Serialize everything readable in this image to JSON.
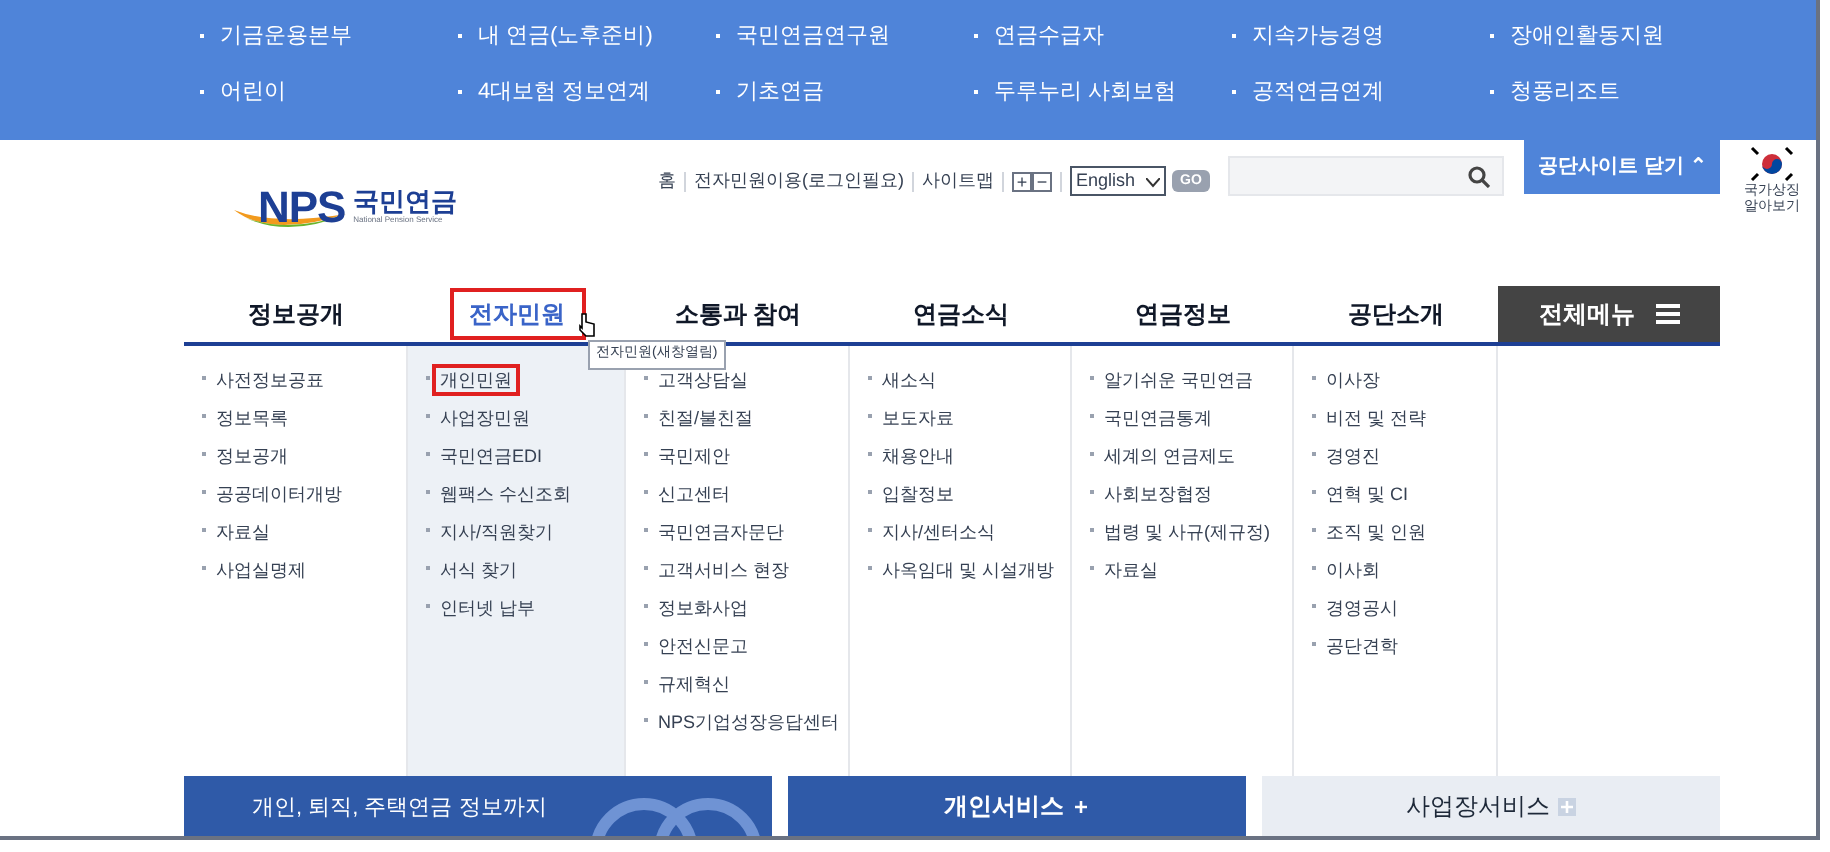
{
  "top_links": [
    [
      "기금운용본부",
      "내 연금(노후준비)",
      "국민연금연구원",
      "연금수급자",
      "지속가능경영",
      "장애인활동지원"
    ],
    [
      "어린이",
      "4대보험 정보연계",
      "기초연금",
      "두루누리 사회보험",
      "공적연금연계",
      "청풍리조트"
    ]
  ],
  "logo": {
    "mark": "NPS",
    "name": "국민연금",
    "tagline": "National Pension Service"
  },
  "utility_links": [
    "홈",
    "전자민원이용(로그인필요)",
    "사이트맵"
  ],
  "font_size_buttons": [
    "+",
    "−"
  ],
  "language_select": {
    "value": "English"
  },
  "go_button": "GO",
  "close_sites_button": "공단사이트 닫기 ⌃",
  "national_symbol": {
    "label": "국가상징 알아보기"
  },
  "nav": [
    {
      "label": "정보공개",
      "selected": false,
      "highlighted": false,
      "items": [
        {
          "label": "사전정보공표",
          "highlighted": false
        },
        {
          "label": "정보목록",
          "highlighted": false
        },
        {
          "label": "정보공개",
          "highlighted": false
        },
        {
          "label": "공공데이터개방",
          "highlighted": false
        },
        {
          "label": "자료실",
          "highlighted": false
        },
        {
          "label": "사업실명제",
          "highlighted": false
        }
      ]
    },
    {
      "label": "전자민원",
      "selected": true,
      "highlighted": true,
      "tooltip": "전자민원(새창열림)",
      "items": [
        {
          "label": "개인민원",
          "highlighted": true
        },
        {
          "label": "사업장민원",
          "highlighted": false
        },
        {
          "label": "국민연금EDI",
          "highlighted": false
        },
        {
          "label": "웹팩스 수신조회",
          "highlighted": false
        },
        {
          "label": "지사/직원찾기",
          "highlighted": false
        },
        {
          "label": "서식 찾기",
          "highlighted": false
        },
        {
          "label": "인터넷 납부",
          "highlighted": false
        }
      ]
    },
    {
      "label": "소통과 참여",
      "selected": false,
      "highlighted": false,
      "items": [
        {
          "label": "고객상담실",
          "highlighted": false
        },
        {
          "label": "친절/불친절",
          "highlighted": false
        },
        {
          "label": "국민제안",
          "highlighted": false
        },
        {
          "label": "신고센터",
          "highlighted": false
        },
        {
          "label": "국민연금자문단",
          "highlighted": false
        },
        {
          "label": "고객서비스 현장",
          "highlighted": false
        },
        {
          "label": "정보화사업",
          "highlighted": false
        },
        {
          "label": "안전신문고",
          "highlighted": false
        },
        {
          "label": "규제혁신",
          "highlighted": false
        },
        {
          "label": "NPS기업성장응답센터",
          "highlighted": false
        }
      ]
    },
    {
      "label": "연금소식",
      "selected": false,
      "highlighted": false,
      "items": [
        {
          "label": "새소식",
          "highlighted": false
        },
        {
          "label": "보도자료",
          "highlighted": false
        },
        {
          "label": "채용안내",
          "highlighted": false
        },
        {
          "label": "입찰정보",
          "highlighted": false
        },
        {
          "label": "지사/센터소식",
          "highlighted": false
        },
        {
          "label": "사옥임대 및 시설개방",
          "highlighted": false
        }
      ]
    },
    {
      "label": "연금정보",
      "selected": false,
      "highlighted": false,
      "items": [
        {
          "label": "알기쉬운 국민연금",
          "highlighted": false
        },
        {
          "label": "국민연금통계",
          "highlighted": false
        },
        {
          "label": "세계의 연금제도",
          "highlighted": false
        },
        {
          "label": "사회보장협정",
          "highlighted": false
        },
        {
          "label": "법령 및 사규(제규정)",
          "highlighted": false
        },
        {
          "label": "자료실",
          "highlighted": false
        }
      ]
    },
    {
      "label": "공단소개",
      "selected": false,
      "highlighted": false,
      "items": [
        {
          "label": "이사장",
          "highlighted": false
        },
        {
          "label": "비전 및 전략",
          "highlighted": false
        },
        {
          "label": "경영진",
          "highlighted": false
        },
        {
          "label": "연혁 및 CI",
          "highlighted": false
        },
        {
          "label": "조직 및 인원",
          "highlighted": false
        },
        {
          "label": "이사회",
          "highlighted": false
        },
        {
          "label": "경영공시",
          "highlighted": false
        },
        {
          "label": "공단견학",
          "highlighted": false
        }
      ]
    }
  ],
  "all_menu_button": "전체메뉴",
  "banner": {
    "text": "개인, 퇴직, 주택연금 정보까지"
  },
  "service_tabs": [
    {
      "label": "개인서비스",
      "selected": true
    },
    {
      "label": "사업장서비스",
      "selected": false
    }
  ]
}
